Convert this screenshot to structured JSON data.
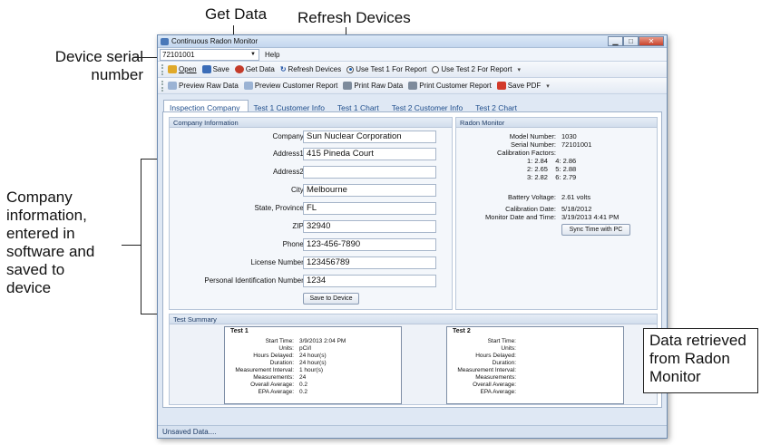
{
  "annotations": {
    "get_data": "Get Data",
    "refresh_devices": "Refresh Devices",
    "device_serial_line1": "Device serial",
    "device_serial_line2": "number",
    "company_info_lines": [
      "Company",
      "information,",
      "entered in",
      "software and",
      "saved to",
      "device"
    ],
    "data_retrieved_lines": [
      "Data retrieved",
      "from Radon",
      "Monitor"
    ]
  },
  "window": {
    "title": "Continuous Radon Monitor",
    "controls": {
      "minimize": "▁",
      "maximize": "□",
      "close": "✕"
    }
  },
  "menubar": {
    "serial_value": "72101001",
    "help": "Help"
  },
  "toolbar1": {
    "open": "Open",
    "save": "Save",
    "get_data": "Get Data",
    "refresh_devices": "Refresh Devices",
    "use_test1": "Use Test 1 For Report",
    "use_test2": "Use Test 2 For Report",
    "selected_test": 1,
    "colors": {
      "open": "#e0a92a",
      "save": "#3b6db8",
      "get_data": "#c43b2a",
      "refresh": "#2a5aa8"
    }
  },
  "toolbar2": {
    "preview_raw": "Preview Raw Data",
    "preview_customer": "Preview Customer Report",
    "print_raw": "Print Raw Data",
    "print_customer": "Print Customer Report",
    "save_pdf": "Save PDF"
  },
  "tabs": [
    "Inspection Company",
    "Test 1 Customer Info",
    "Test 1 Chart",
    "Test 2 Customer Info",
    "Test 2 Chart"
  ],
  "company_panel": {
    "header": "Company Information",
    "fields": [
      {
        "label": "Company:",
        "value": "Sun Nuclear Corporation"
      },
      {
        "label": "Address1:",
        "value": "415 Pineda Court"
      },
      {
        "label": "Address2:",
        "value": ""
      },
      {
        "label": "City:",
        "value": "Melbourne"
      },
      {
        "label": "State, Province:",
        "value": "FL"
      },
      {
        "label": "ZIP:",
        "value": "32940"
      },
      {
        "label": "Phone:",
        "value": "123-456-7890"
      },
      {
        "label": "License Number:",
        "value": "123456789"
      },
      {
        "label": "Personal Identification Number:",
        "value": "1234"
      }
    ],
    "save_button": "Save to Device"
  },
  "radon_panel": {
    "header": "Radon Monitor",
    "model_label": "Model Number:",
    "model_value": "1030",
    "serial_label": "Serial Number:",
    "serial_value": "72101001",
    "cal_label": "Calibration Factors:",
    "cal_row1": "1: 2.84    4: 2.86",
    "cal_row2": "2: 2.65    5: 2.88",
    "cal_row3": "3: 2.82    6: 2.79",
    "battery_label": "Battery Voltage:",
    "battery_value": "2.61 volts",
    "caldate_label": "Calibration Date:",
    "caldate_value": "5/18/2012",
    "monitor_date_label": "Monitor Date and Time:",
    "monitor_date_value": "3/19/2013 4:41 PM",
    "sync_button": "Sync Time with PC"
  },
  "test_summary": {
    "header": "Test Summary",
    "labels": [
      "Start Time:",
      "Units:",
      "Hours Delayed:",
      "Duration:",
      "Measurement Interval:",
      "Measurements:",
      "Overall Average:",
      "EPA Average:"
    ],
    "test1": {
      "title": "Test 1",
      "values": [
        "3/9/2013 2:04 PM",
        "pCi/l",
        "24 hour(s)",
        "24 hour(s)",
        "1 hour(s)",
        "24",
        "0.2",
        "0.2"
      ]
    },
    "test2": {
      "title": "Test 2",
      "values": [
        "",
        "",
        "",
        "",
        "",
        "",
        "",
        ""
      ]
    }
  },
  "status": "Unsaved Data...."
}
